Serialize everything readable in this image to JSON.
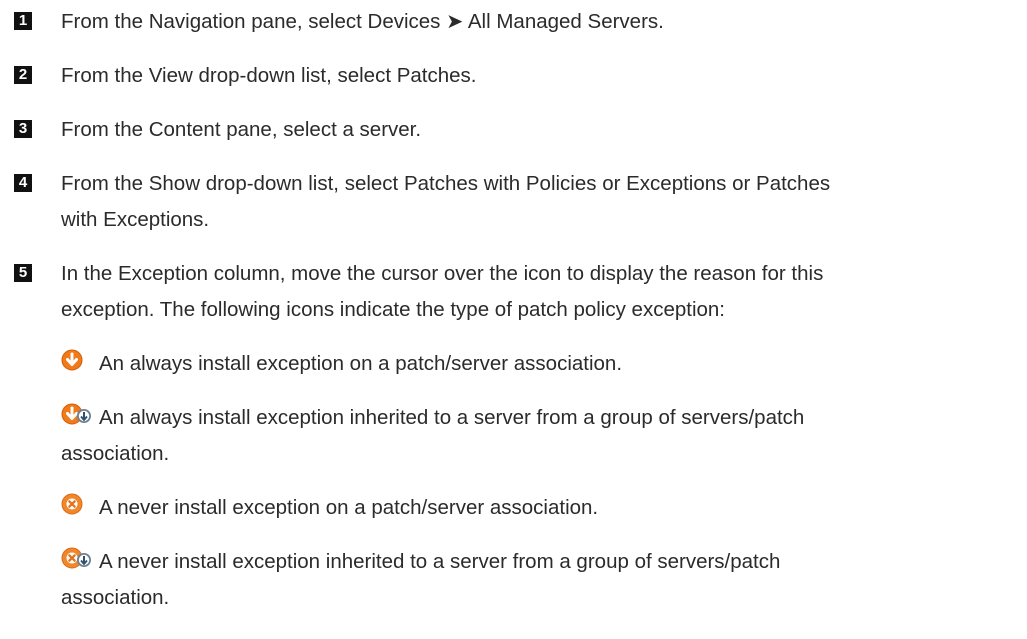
{
  "steps": [
    {
      "number": "1",
      "text": "From the Navigation pane, select Devices ➤ All Managed Servers."
    },
    {
      "number": "2",
      "text": "From the View drop-down list, select Patches."
    },
    {
      "number": "3",
      "text": "From the Content pane, select a server."
    },
    {
      "number": "4",
      "line1": "From the Show drop-down list, select Patches with Policies or Exceptions or Patches",
      "line2": "with Exceptions."
    },
    {
      "number": "5",
      "line1": "In the Exception column, move the cursor over the icon to display the reason for this",
      "line2": "exception. The following icons indicate the type of patch policy exception:"
    }
  ],
  "exception_icons": [
    {
      "icon": "always-install-icon",
      "color": "#f07a1a",
      "text": "An always install exception on a patch/server association."
    },
    {
      "icon": "always-install-inherited-icon",
      "color": "#f07a1a",
      "line1": "An always install exception inherited to a server from a group of servers/patch",
      "line2": "association."
    },
    {
      "icon": "never-install-icon",
      "color": "#f0882a",
      "text": "A never install exception on a patch/server association."
    },
    {
      "icon": "never-install-inherited-icon",
      "color": "#f0882a",
      "line1": "A never install exception inherited to a server from a group of servers/patch",
      "line2": "association."
    }
  ]
}
